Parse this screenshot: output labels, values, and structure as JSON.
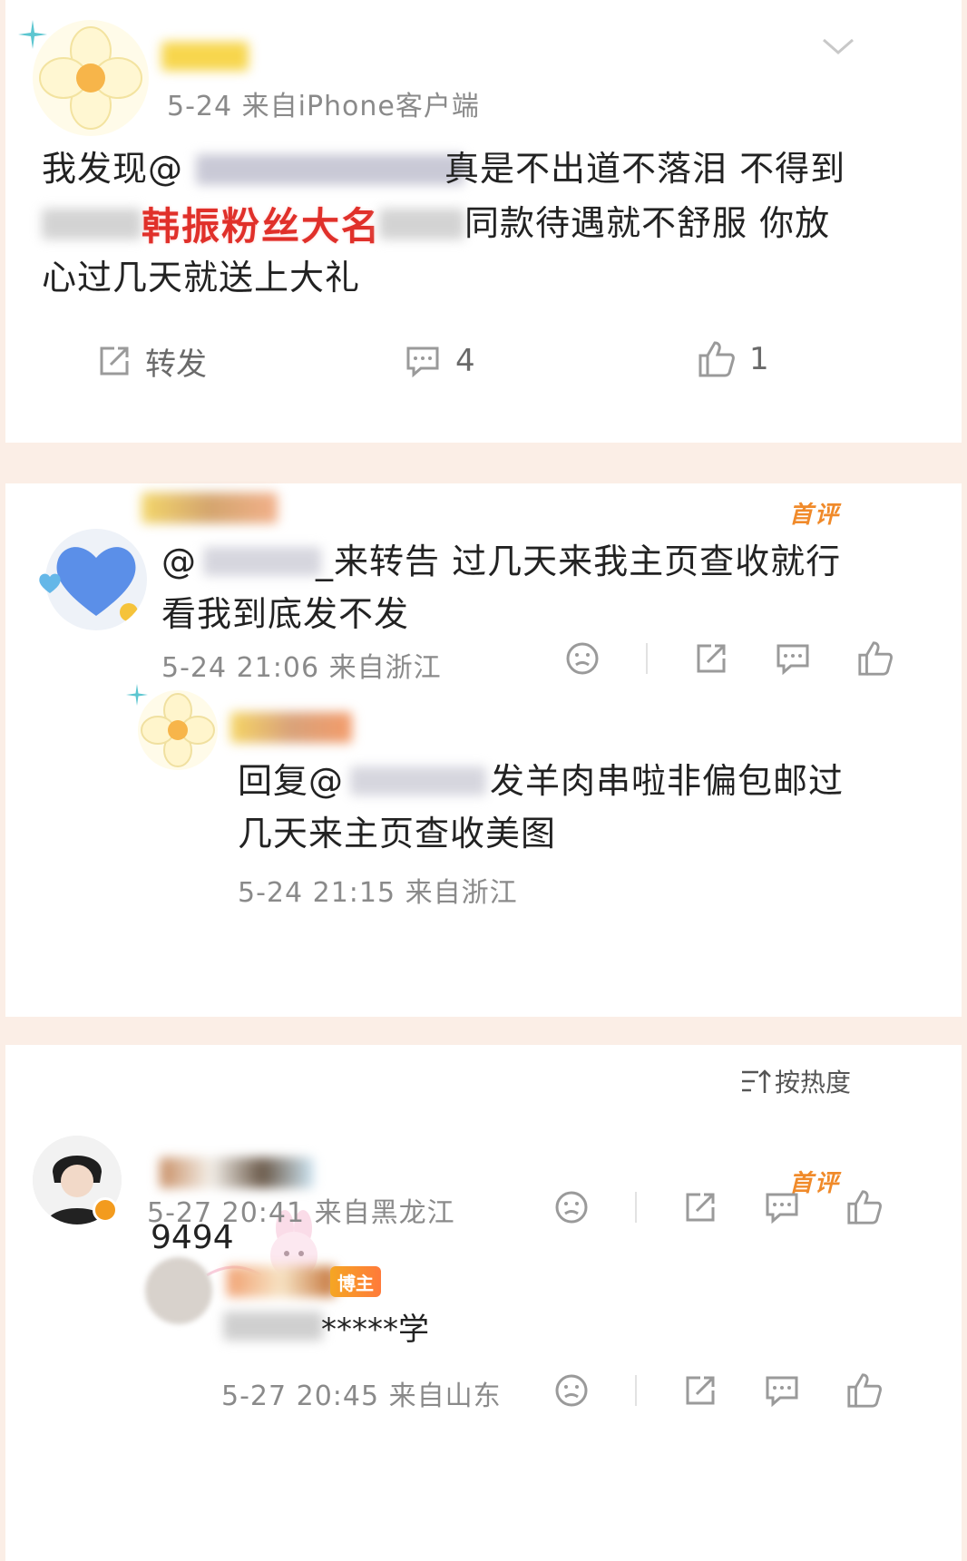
{
  "post": {
    "meta": "5-24  来自iPhone客户端",
    "text_line1_a": "我发现@",
    "text_line1_b": "真是不出道不落泪 不得到",
    "text_line2_highlight": "韩振粉丝大名",
    "text_line2_b": "同款待遇就不舒服 你放",
    "text_line3": "心过几天就送上大礼",
    "actions": {
      "repost_label": "转发",
      "comment_count": "4",
      "like_count": "1"
    }
  },
  "comment1": {
    "badge": "首评",
    "text_line1_a": "@",
    "text_line1_b": "_来转告 过几天来我主页查收就行",
    "text_line2": "看我到底发不发",
    "meta": "5-24 21:06 来自浙江"
  },
  "reply1": {
    "prefix": "回复@",
    "text_line1_b": "发羊肉串啦非偏包邮过",
    "text_line2": "几天来主页查收美图",
    "meta": "5-24 21:15 来自浙江"
  },
  "sort": {
    "label": "按热度"
  },
  "comment2": {
    "badge": "首评",
    "text": "9494",
    "meta": "5-27 20:41 来自黑龙江"
  },
  "reply2": {
    "chip": "博主",
    "text": "*****学",
    "meta": "5-27 20:45 来自山东"
  },
  "colors": {
    "background": "#fbeee6",
    "accent_orange": "#f08a2a",
    "highlight_red": "#e0302a",
    "meta_grey": "#8a8a8a"
  }
}
